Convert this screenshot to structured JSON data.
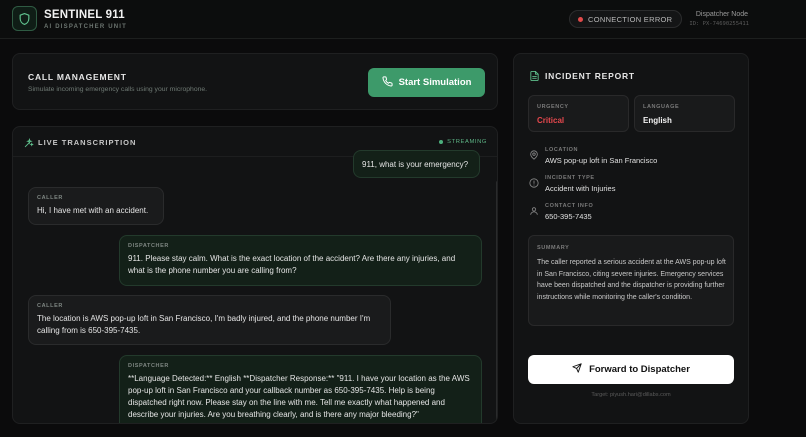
{
  "header": {
    "title": "SENTINEL 911",
    "subtitle": "AI DISPATCHER UNIT",
    "connection_status": "CONNECTION ERROR",
    "node_label": "Dispatcher Node",
    "node_id": "ID: PX-74690255411",
    "status_color": "#e24a4a"
  },
  "call_management": {
    "title": "CALL MANAGEMENT",
    "subtitle": "Simulate incoming emergency calls using your microphone.",
    "start_button": "Start Simulation",
    "accent_color": "#3d9a6a"
  },
  "transcription": {
    "title": "LIVE TRANSCRIPTION",
    "status": "STREAMING",
    "messages": [
      {
        "speaker": "",
        "role": "dispatcher",
        "text": "911, what is your emergency?"
      },
      {
        "speaker": "CALLER",
        "role": "caller",
        "text": "Hi, I have met with an accident."
      },
      {
        "speaker": "DISPATCHER",
        "role": "dispatcher",
        "text": "911. Please stay calm. What is the exact location of the accident? Are there any injuries, and what is the phone number you are calling from?"
      },
      {
        "speaker": "CALLER",
        "role": "caller",
        "text": "The location is AWS pop-up loft in San Francisco, I'm badly injured, and the phone number I'm calling from is 650-395-7435."
      },
      {
        "speaker": "DISPATCHER",
        "role": "dispatcher",
        "text": "**Language Detected:** English **Dispatcher Response:** \"911. I have your location as the AWS pop-up loft in San Francisco and your callback number as 650-395-7435. Help is being dispatched right now. Please stay on the line with me. Tell me exactly what happened and describe your injuries. Are you breathing clearly, and is there any major bleeding?\""
      }
    ]
  },
  "incident_report": {
    "title": "INCIDENT REPORT",
    "urgency_label": "URGENCY",
    "urgency_value": "Critical",
    "urgency_color": "#e5484d",
    "language_label": "LANGUAGE",
    "language_value": "English",
    "location_label": "LOCATION",
    "location_value": "AWS pop-up loft in San Francisco",
    "incident_type_label": "INCIDENT TYPE",
    "incident_type_value": "Accident with Injuries",
    "contact_label": "CONTACT INFO",
    "contact_value": "650-395-7435",
    "summary_label": "SUMMARY",
    "summary_text": "The caller reported a serious accident at the AWS pop-up loft in San Francisco, citing severe injuries. Emergency services have been dispatched and the dispatcher is providing further instructions while monitoring the caller's condition.",
    "forward_button": "Forward to Dispatcher",
    "target": "Target: piyush.hari@dillabs.com"
  }
}
